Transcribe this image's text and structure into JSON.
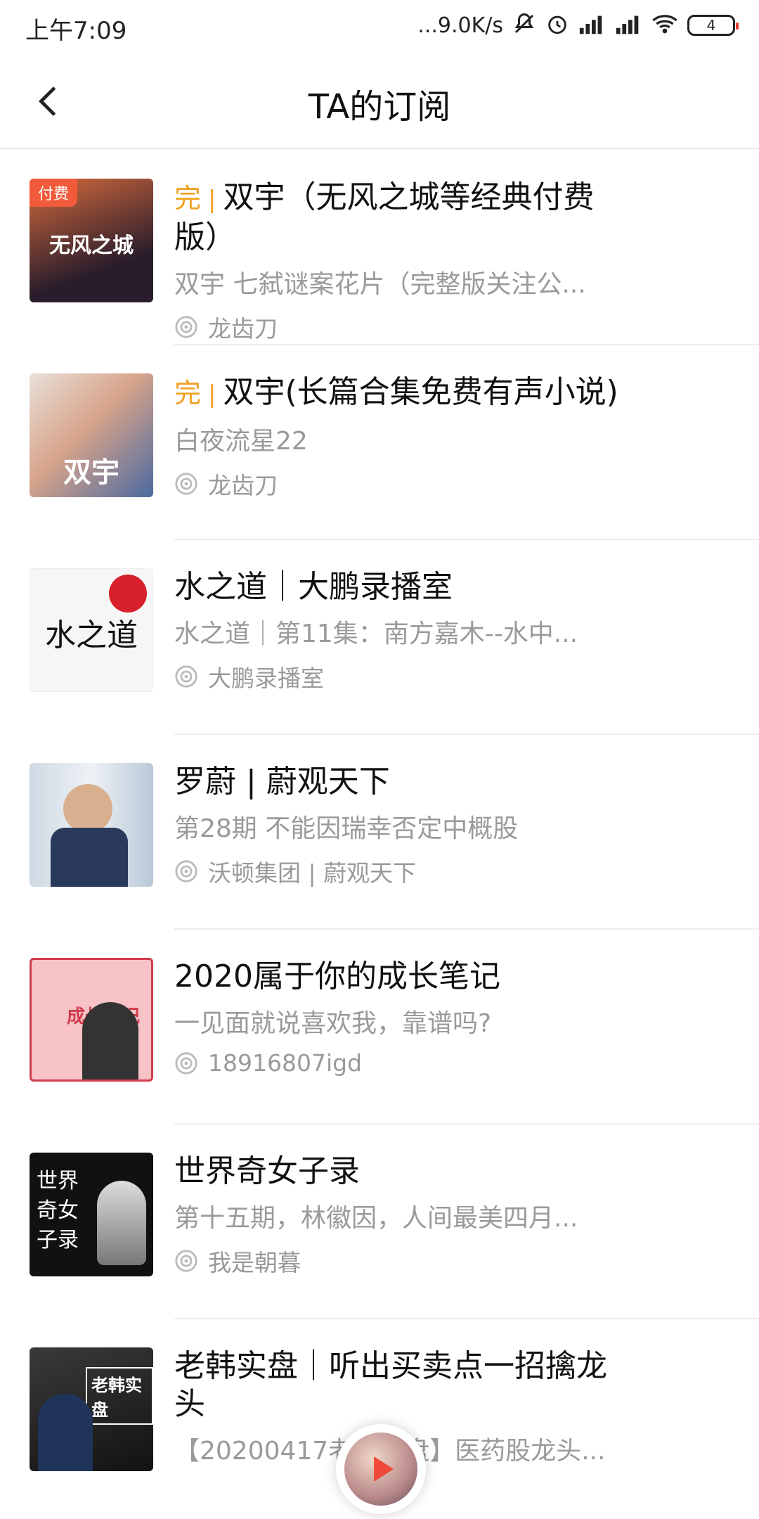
{
  "status": {
    "time": "上午7:09",
    "network": "...9.0K/s",
    "battery": "4"
  },
  "header": {
    "title": "TA的订阅"
  },
  "items": [
    {
      "badge": "付费",
      "complete": "完",
      "title": "双宇（无风之城等经典付费版）",
      "subtitle": "双宇 七弑谜案花片（完整版关注公...",
      "author": "龙齿刀",
      "cover_label": "无风之城"
    },
    {
      "complete": "完",
      "title": "双宇(长篇合集免费有声小说)",
      "subtitle": "白夜流星22",
      "author": "龙齿刀",
      "cover_label": "双宇"
    },
    {
      "title": "水之道｜大鹏录播室",
      "subtitle": "水之道｜第11集：南方嘉木--水中...",
      "author": "大鹏录播室",
      "cover_label": "水之道"
    },
    {
      "title": "罗蔚 | 蔚观天下",
      "subtitle": "第28期 不能因瑞幸否定中概股",
      "author": "沃顿集团 | 蔚观天下",
      "cover_label": ""
    },
    {
      "title": "2020属于你的成长笔记",
      "subtitle": "一见面就说喜欢我，靠谱吗?",
      "author": "18916807igd",
      "cover_label": "成长笔记"
    },
    {
      "title": "世界奇女子录",
      "subtitle": "第十五期，林徽因，人间最美四月...",
      "author": "我是朝暮",
      "cover_label": "世界奇女子录"
    },
    {
      "title": "老韩实盘｜听出买卖点一招擒龙头",
      "subtitle": "【20200417老韩实盘】医药股龙头...",
      "author": "",
      "cover_label": "老韩实盘"
    }
  ]
}
